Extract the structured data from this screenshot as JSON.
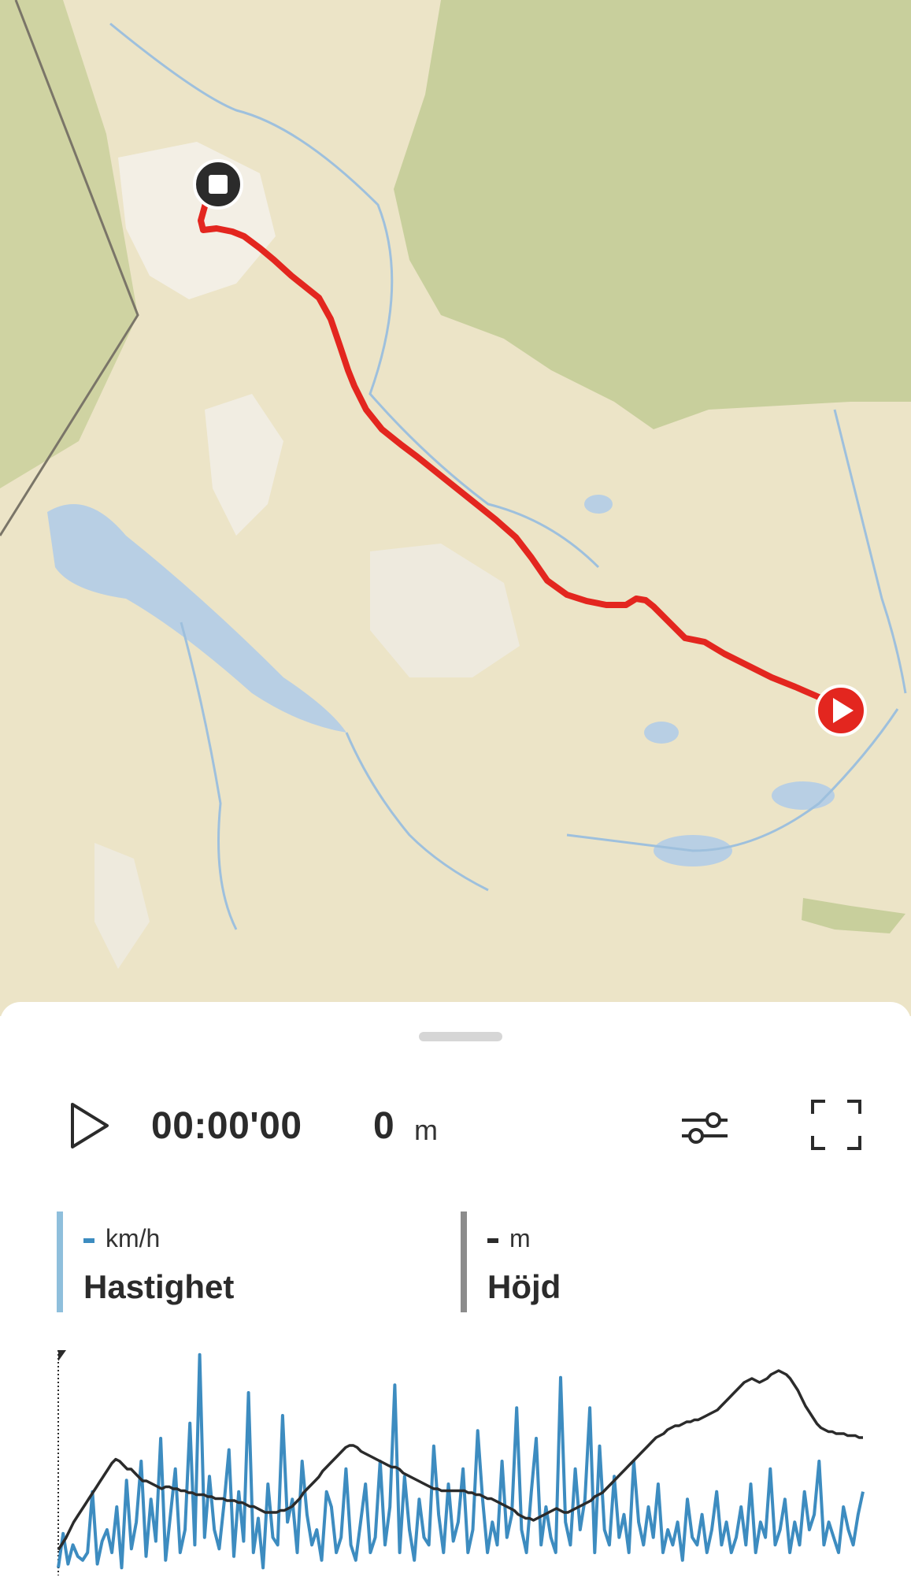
{
  "map": {
    "route_color": "#e3261f",
    "start_marker_icon": "play-icon",
    "end_marker_icon": "stop-icon",
    "land_color": "#ece4c7",
    "forest_color": "#c8cf9c",
    "water_color": "#b8cfe4"
  },
  "playback": {
    "play_icon": "play-outline-icon",
    "time": "00:00'00",
    "distance_value": "0",
    "distance_unit": "m",
    "settings_icon": "sliders-icon",
    "fullscreen_icon": "fullscreen-icon"
  },
  "metrics": [
    {
      "label": "Hastighet",
      "unit": "km/h",
      "value": "-",
      "color": "#3d8cc0"
    },
    {
      "label": "Höjd",
      "unit": "m",
      "value": "-",
      "color": "#2b2b2b"
    }
  ],
  "chart_data": {
    "type": "line",
    "title": "",
    "xlabel": "",
    "ylabel": "",
    "grid": false,
    "series": [
      {
        "name": "Hastighet",
        "color": "#3d8cc0",
        "values": [
          2,
          11,
          3,
          8,
          5,
          4,
          6,
          22,
          3,
          9,
          12,
          6,
          18,
          2,
          25,
          7,
          14,
          30,
          5,
          20,
          9,
          36,
          4,
          16,
          28,
          6,
          12,
          40,
          8,
          58,
          10,
          26,
          12,
          7,
          19,
          33,
          5,
          22,
          9,
          48,
          6,
          15,
          2,
          24,
          10,
          8,
          42,
          14,
          20,
          6,
          30,
          16,
          8,
          12,
          4,
          22,
          18,
          6,
          10,
          28,
          8,
          4,
          14,
          24,
          6,
          10,
          30,
          8,
          18,
          50,
          6,
          26,
          12,
          4,
          20,
          10,
          8,
          34,
          16,
          6,
          24,
          9,
          14,
          28,
          6,
          12,
          38,
          20,
          6,
          14,
          8,
          30,
          10,
          16,
          44,
          12,
          6,
          22,
          36,
          8,
          18,
          10,
          6,
          52,
          14,
          8,
          28,
          12,
          20,
          44,
          6,
          34,
          12,
          8,
          26,
          10,
          16,
          6,
          30,
          14,
          8,
          18,
          10,
          24,
          6,
          12,
          8,
          14,
          4,
          20,
          10,
          8,
          16,
          6,
          12,
          22,
          8,
          14,
          6,
          10,
          18,
          8,
          24,
          6,
          14,
          10,
          28,
          8,
          12,
          20,
          6,
          14,
          8,
          22,
          12,
          16,
          30,
          8,
          14,
          10,
          6,
          18,
          12,
          8,
          16,
          22
        ]
      },
      {
        "name": "Höjd",
        "color": "#2b2b2b",
        "values": [
          5,
          8,
          11,
          15,
          19,
          22,
          25,
          28,
          31,
          34,
          37,
          40,
          43,
          46,
          49,
          51,
          50,
          48,
          46,
          46,
          44,
          42,
          40,
          40,
          39,
          38,
          37,
          36,
          37,
          37,
          36,
          36,
          35,
          35,
          34,
          34,
          33,
          33,
          33,
          32,
          32,
          31,
          31,
          31,
          30,
          30,
          30,
          29,
          29,
          28,
          27,
          27,
          26,
          25,
          24,
          24,
          24,
          24,
          25,
          25,
          26,
          27,
          29,
          31,
          34,
          36,
          38,
          40,
          42,
          45,
          47,
          49,
          51,
          53,
          55,
          57,
          58,
          58,
          57,
          55,
          54,
          53,
          52,
          51,
          50,
          49,
          48,
          47,
          47,
          46,
          44,
          43,
          42,
          41,
          40,
          39,
          38,
          37,
          36,
          36,
          35,
          35,
          35,
          35,
          35,
          35,
          35,
          34,
          34,
          33,
          33,
          32,
          31,
          31,
          30,
          29,
          28,
          27,
          26,
          25,
          23,
          22,
          21,
          21,
          20,
          21,
          22,
          23,
          24,
          25,
          26,
          25,
          24,
          24,
          25,
          26,
          27,
          28,
          29,
          30,
          32,
          33,
          34,
          36,
          38,
          40,
          42,
          44,
          46,
          48,
          50,
          52,
          54,
          56,
          58,
          60,
          62,
          63,
          64,
          66,
          67,
          68,
          68,
          69,
          70,
          70,
          71,
          71,
          72,
          73,
          74,
          75,
          76,
          78,
          80,
          82,
          84,
          86,
          88,
          90,
          91,
          92,
          91,
          90,
          91,
          92,
          94,
          95,
          96,
          95,
          94,
          92,
          89,
          86,
          82,
          78,
          75,
          72,
          69,
          67,
          66,
          65,
          65,
          64,
          64,
          64,
          63,
          63,
          63,
          62,
          62
        ]
      }
    ]
  }
}
